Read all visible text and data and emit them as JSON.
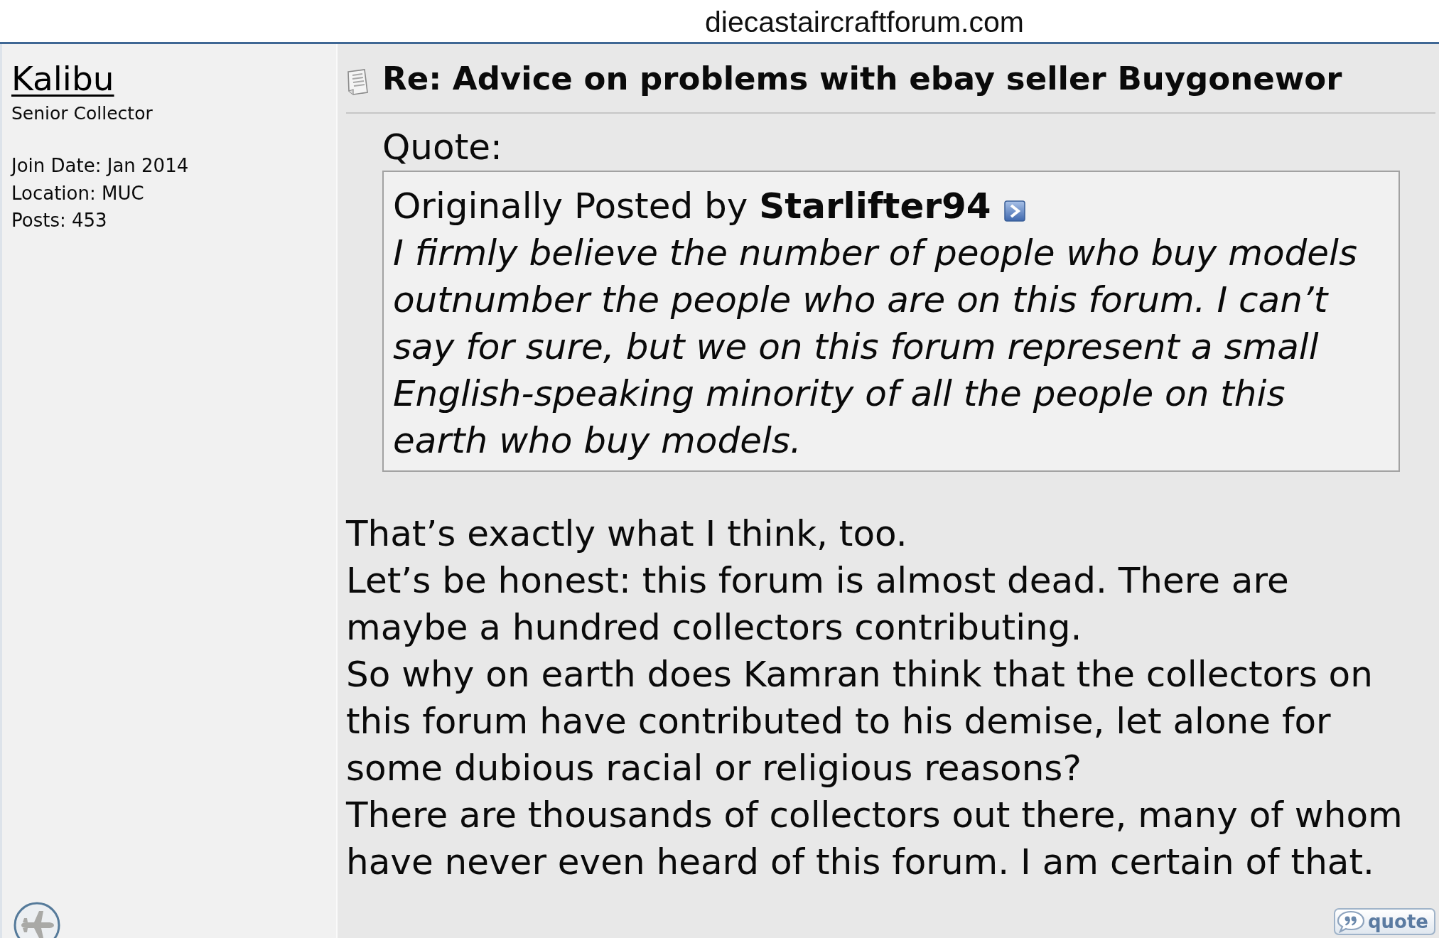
{
  "browser_bar": {
    "url": "diecastaircraftforum.com"
  },
  "user": {
    "name": "Kalibu",
    "title": "Senior Collector",
    "details": [
      "Join Date: Jan 2014",
      "Location: MUC",
      "Posts: 453"
    ]
  },
  "post": {
    "title": "Re: Advice on problems with ebay seller Buygonewor",
    "quote": {
      "label": "Quote:",
      "attribution": "Originally Posted by **Starlifter94**",
      "text": "I firmly believe the number of people who buy models\noutnumber the people who are on this forum. I can’t\nsay for sure, but we on this forum represent a small\nEnglish-speaking minority of all the people on this\nearth who buy models."
    },
    "paragraphs": [
      "That’s exactly what I think, too.",
      "Let’s be honest: this forum is almost dead. There are\nmaybe a hundred collectors contributing.",
      "So why on earth does Kamran think that the collectors on\nthis forum have contributed to his demise, let alone for\nsome dubious racial or religious reasons?",
      "There are thousands of collectors out there, many of whom\nhave never even heard of this forum. I am certain of that."
    ],
    "quote_button": {
      "label": "quote"
    }
  }
}
